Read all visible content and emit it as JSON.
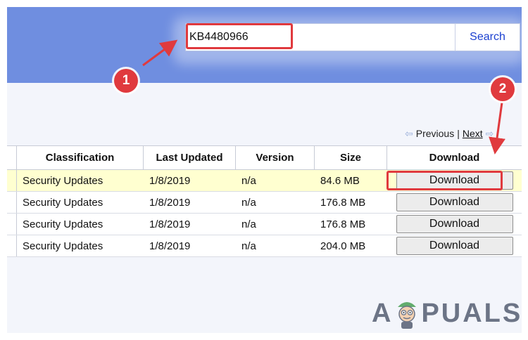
{
  "search": {
    "value": "KB4480966",
    "button_label": "Search"
  },
  "pager": {
    "previous_label": "Previous",
    "separator": "|",
    "next_label": "Next"
  },
  "table": {
    "columns": [
      "Classification",
      "Last Updated",
      "Version",
      "Size",
      "Download"
    ],
    "rows": [
      {
        "classification": "Security Updates",
        "last_updated": "1/8/2019",
        "version": "n/a",
        "size": "84.6 MB",
        "download_label": "Download"
      },
      {
        "classification": "Security Updates",
        "last_updated": "1/8/2019",
        "version": "n/a",
        "size": "176.8 MB",
        "download_label": "Download"
      },
      {
        "classification": "Security Updates",
        "last_updated": "1/8/2019",
        "version": "n/a",
        "size": "176.8 MB",
        "download_label": "Download"
      },
      {
        "classification": "Security Updates",
        "last_updated": "1/8/2019",
        "version": "n/a",
        "size": "204.0 MB",
        "download_label": "Download"
      }
    ]
  },
  "annotations": {
    "step1": "1",
    "step2": "2",
    "accent_color": "#e03a3e"
  },
  "watermark": {
    "text_left": "A",
    "text_right": "PUALS"
  },
  "colors": {
    "header_band": "#6f8ee0",
    "search_link": "#1a3fd0",
    "selected_row": "#ffffd0"
  }
}
